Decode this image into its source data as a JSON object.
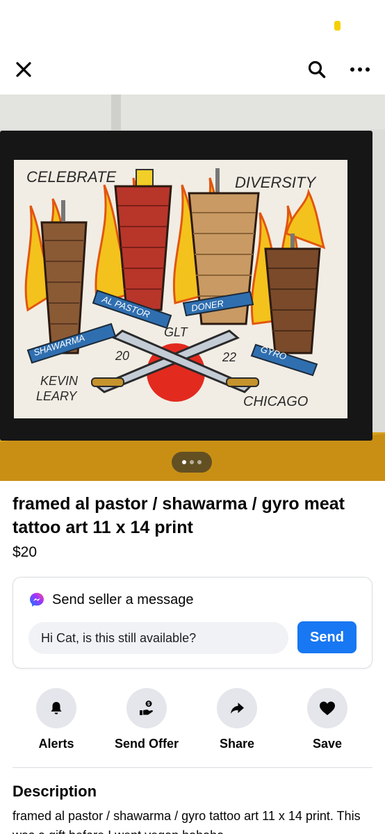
{
  "header": {
    "close_icon": "close-icon",
    "search_icon": "search-icon",
    "more_icon": "more-horizontal-icon"
  },
  "photo": {
    "print_text": {
      "top_left": "CELEBRATE",
      "top_right": "DIVERSITY",
      "banner_1": "SHAWARMA",
      "banner_2": "AL PASTOR",
      "banner_3": "DONER",
      "banner_4": "GYRO",
      "center": "GLT",
      "year_left": "20",
      "year_right": "22",
      "artist_line1": "KEVIN",
      "artist_line2": "LEARY",
      "city": "CHICAGO"
    },
    "page_indicator": {
      "count": 3,
      "active": 0
    }
  },
  "listing": {
    "title": "framed al pastor / shawarma / gyro meat tattoo art 11 x 14 print",
    "price": "$20"
  },
  "message": {
    "icon": "messenger-icon",
    "heading": "Send seller a message",
    "input_value": "Hi Cat, is this still available?",
    "send_label": "Send"
  },
  "actions": [
    {
      "label": "Alerts",
      "icon": "bell-icon"
    },
    {
      "label": "Send Offer",
      "icon": "offer-icon"
    },
    {
      "label": "Share",
      "icon": "share-icon"
    },
    {
      "label": "Save",
      "icon": "heart-icon"
    }
  ],
  "description": {
    "heading": "Description",
    "text": "framed al pastor / shawarma / gyro tattoo art 11 x 14 print. This was a gift before I went vegan hahaha"
  },
  "colors": {
    "accent": "#1877f2",
    "circle_bg": "#e4e6eb",
    "input_bg": "#f0f2f5"
  }
}
